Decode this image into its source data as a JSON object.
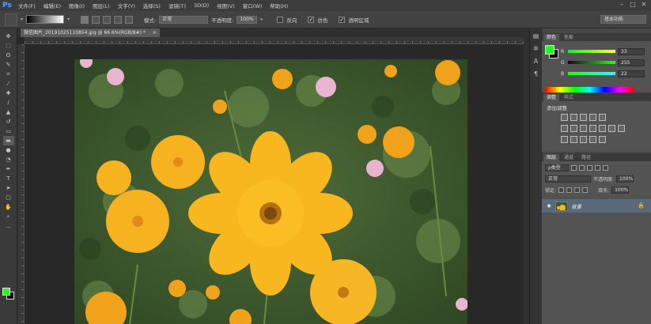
{
  "app": {
    "logo": "Ps"
  },
  "menu": [
    "文件(F)",
    "编辑(E)",
    "图像(I)",
    "图层(L)",
    "文字(Y)",
    "选择(S)",
    "滤镜(T)",
    "3D(D)",
    "视图(V)",
    "窗口(W)",
    "帮助(H)"
  ],
  "window_controls": [
    "–",
    "□",
    "✕"
  ],
  "options_bar": {
    "mode_label": "模式:",
    "mode_value": "正常",
    "opacity_label": "不透明度:",
    "opacity_value": "100%",
    "reverse_label": "反向",
    "dither_label": "仿色",
    "transparency_label": "透明区域",
    "workspace": "基本功能"
  },
  "document": {
    "tab_title": "微信图片_20191025110854.jpg @ 66.6%(RGB/8#) *",
    "close": "×"
  },
  "color_panel": {
    "tabs": [
      "颜色",
      "色板"
    ],
    "r_label": "R",
    "r_value": "33",
    "g_label": "G",
    "g_value": "255",
    "b_label": "B",
    "b_value": "22",
    "foreground": "#21ff16",
    "background": "#000000"
  },
  "adjust_panel": {
    "tabs": [
      "调整",
      "样式"
    ],
    "title": "添加调整"
  },
  "layers_panel": {
    "tabs": [
      "图层",
      "通道",
      "路径"
    ],
    "filter_label": "ρ类型",
    "blend_mode": "正常",
    "opacity_label": "不透明度:",
    "opacity_value": "100%",
    "lock_label": "锁定:",
    "fill_label": "填充:",
    "fill_value": "100%",
    "layers": [
      {
        "name": "背景",
        "visible": true,
        "locked": true
      }
    ]
  },
  "colors": {
    "ui_dark": "#282828",
    "panel": "#535353",
    "selected_layer": "#596979",
    "foreground_swatch": "#21ff16",
    "background_swatch": "#000000"
  }
}
